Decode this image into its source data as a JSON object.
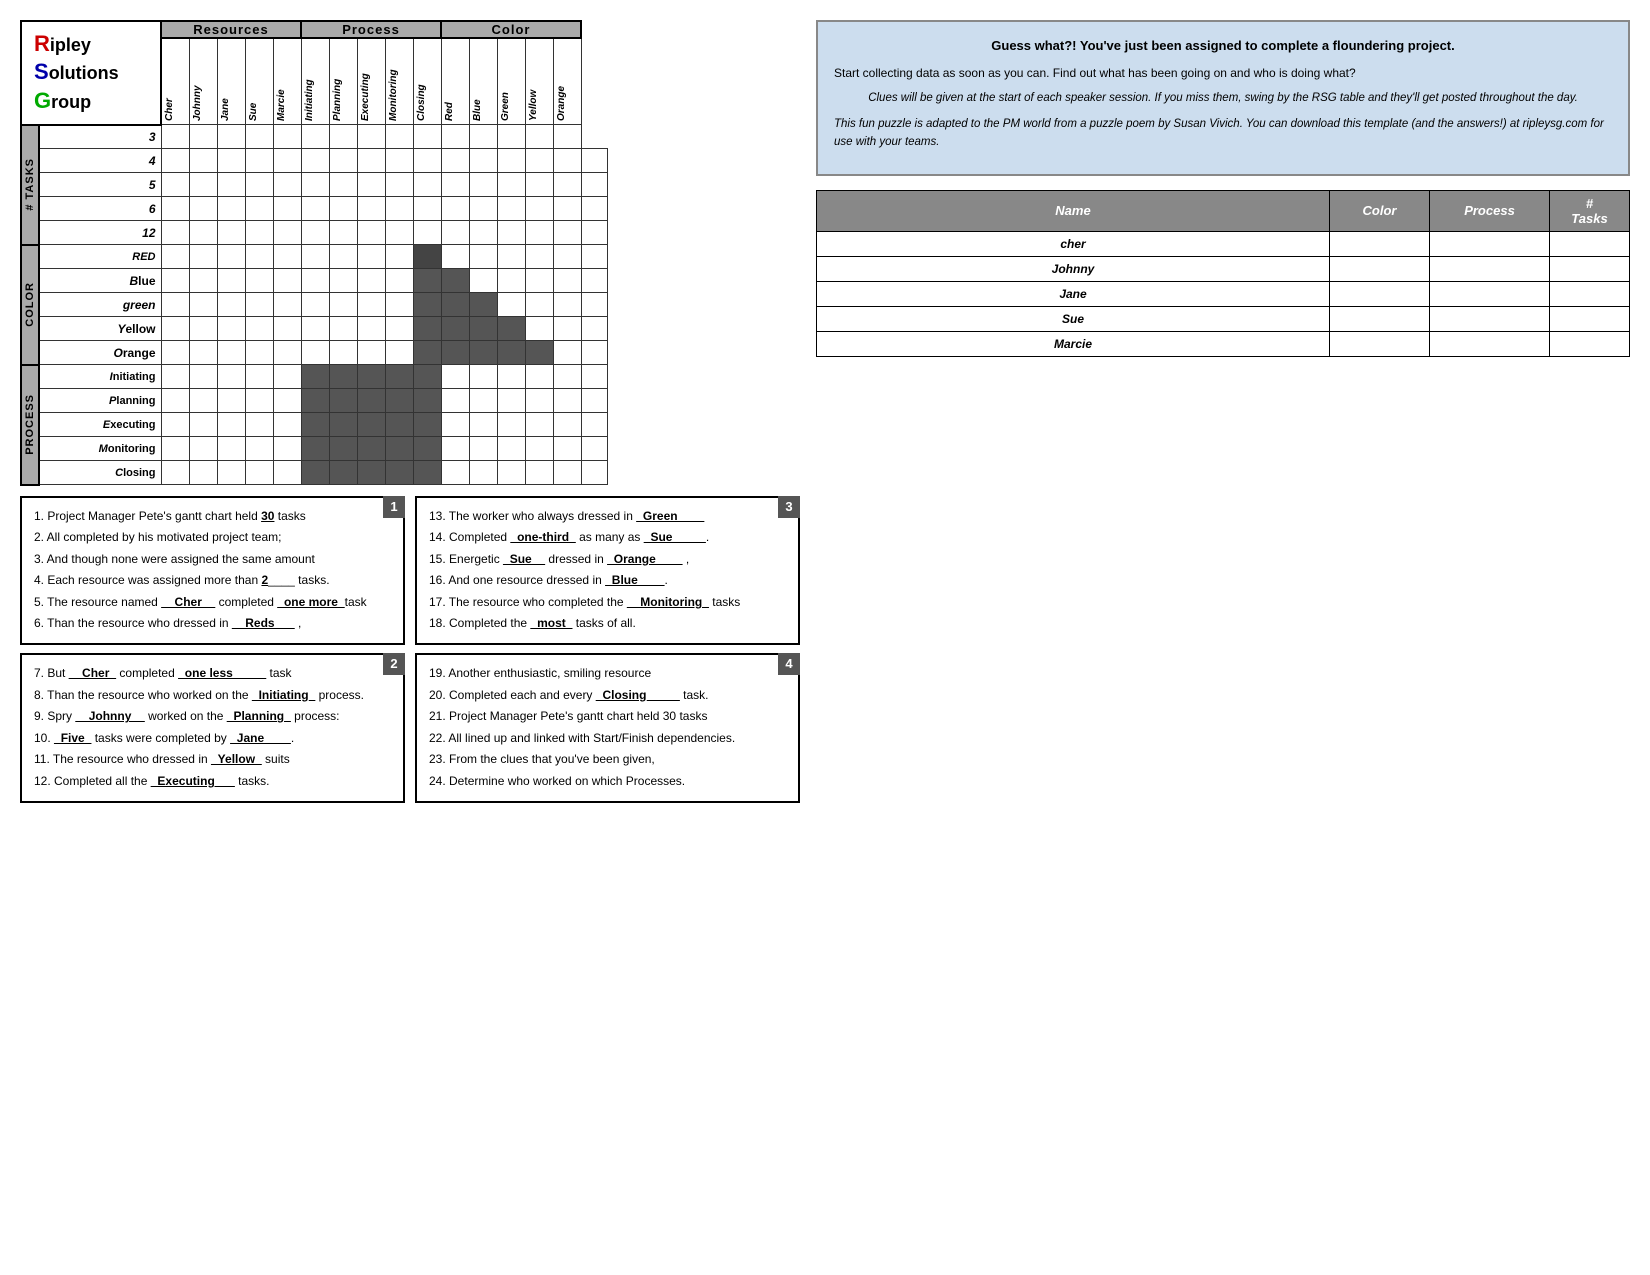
{
  "logo": {
    "line1": "Ripley",
    "line2": "Solutions",
    "line3": "Group",
    "r_letter": "R",
    "s_letter": "S",
    "g_letter": "G"
  },
  "headers": {
    "resources": "Resources",
    "process": "Process",
    "color": "Color"
  },
  "resource_cols": [
    "Cher",
    "Johnny",
    "Jane",
    "Sue",
    "Marcie"
  ],
  "process_cols": [
    "Initiating",
    "Planning",
    "Executing",
    "Monitoring",
    "Closing"
  ],
  "color_cols": [
    "Red",
    "Blue",
    "Green",
    "Yellow",
    "Orange"
  ],
  "row_groups": {
    "tasks": {
      "label": "# Tasks",
      "rows": [
        "3",
        "4",
        "5",
        "6",
        "12"
      ]
    },
    "color": {
      "label": "Color",
      "rows": [
        "Red",
        "Blue",
        "Green",
        "Yellow",
        "Orange"
      ]
    },
    "process": {
      "label": "Process",
      "rows": [
        "Initiating",
        "Planning",
        "Executing",
        "Monitoring",
        "Closing"
      ]
    }
  },
  "info_box": {
    "title": "Guess what?! You've just been assigned to complete a floundering project.",
    "para1": "Start collecting data as soon as you can.  Find out what has been going on and who is doing what?",
    "para2_italic": "Clues will be given at the start of each speaker session.  If you miss them, swing by the RSG table and they'll get posted throughout the day.",
    "para3_italic": "This fun puzzle is adapted to the PM world from a puzzle poem by Susan Vivich.  You can download this template (and the answers!) at ripleysg.com for use with your teams."
  },
  "answer_table": {
    "headers": [
      "Name",
      "Color",
      "Process",
      "# Tasks"
    ],
    "rows": [
      [
        "Cher",
        "",
        "",
        ""
      ],
      [
        "Johnny",
        "",
        "",
        ""
      ],
      [
        "Jane",
        "",
        "",
        ""
      ],
      [
        "Sue",
        "",
        "",
        ""
      ],
      [
        "Marcie",
        "",
        "",
        ""
      ]
    ]
  },
  "clue_boxes": {
    "box1": {
      "number": "1",
      "clues": [
        "1.  Project Manager Pete's gantt chart held __30__ tasks",
        "2.  All completed by his motivated project team;",
        "3.  And though none were assigned the same amount",
        "4.  Each resource was assigned more than __2____ tasks.",
        "5.  The resource named __Cher__ completed _one more_task",
        "6.  Than the resource who dressed in __Reds___ ,"
      ]
    },
    "box2": {
      "number": "2",
      "clues": [
        "7.  But __Cher_ completed _one less_____ task",
        "8.  Than the resource who worked on the _Initiating_ process.",
        "9.  Spry __Johnny__ worked on the _Planning_ process:",
        "10. _Five_ tasks were completed by _Jane____.",
        "11. The resource who dressed in _Yellow_ suits",
        "12. Completed all the _Executing___ tasks."
      ]
    },
    "box3": {
      "number": "3",
      "clues": [
        "13. The worker who always dressed in _Green____",
        "14. Completed _one-third_ as many as _Sue_____.",
        "15. Energetic _Sue__ dressed in _Orange____ ,",
        "16. And one resource dressed in _Blue____.",
        "17. The resource who completed the __Monitoring_ tasks",
        "18. Completed the _most_ tasks of all."
      ]
    },
    "box4": {
      "number": "4",
      "clues": [
        "19. Another enthusiastic, smiling resource",
        "20. Completed each and every _Closing_____ task.",
        "21. Project Manager Pete's gantt chart held 30 tasks",
        "22. All lined up and linked with Start/Finish dependencies.",
        "23. From the clues that you've been given,",
        "24. Determine who worked on which Processes."
      ]
    }
  }
}
